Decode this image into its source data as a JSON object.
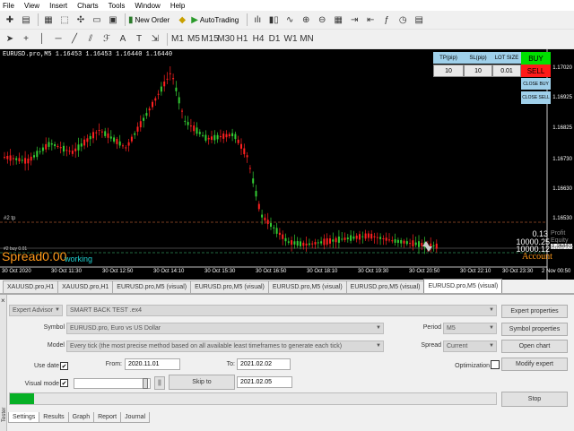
{
  "menu": [
    "File",
    "View",
    "Insert",
    "Charts",
    "Tools",
    "Window",
    "Help"
  ],
  "toolbar": {
    "new_order": "New Order",
    "autotrading": "AutoTrading"
  },
  "chart": {
    "title": "EURUSD.pro,M5  1.16453 1.16453 1.16440 1.16440",
    "y_ticks": [
      "1.17020",
      "1.16925",
      "1.16825",
      "1.16730",
      "1.16630",
      "1.16530",
      "1.16440"
    ],
    "current_price": "1.16440",
    "x_ticks": [
      "30 Oct 2020",
      "30 Oct 11:30",
      "30 Oct 12:50",
      "30 Oct 14:10",
      "30 Oct 15:30",
      "30 Oct 16:50",
      "30 Oct 18:10",
      "30 Oct 19:30",
      "30 Oct 20:50",
      "30 Oct 22:10",
      "30 Oct 23:30",
      "2 Nov 00:50"
    ],
    "tp_label": "#2 tp",
    "buy_line_label": "#2 buy 0.01",
    "spread_label": "Spread",
    "spread_value": "0.00",
    "status": "working",
    "profit_value": "0.13",
    "profit_label": "Profit",
    "equity_value": "10000.25",
    "equity_label": "Equity",
    "balance_value": "10000.12",
    "balance_label": "Balance",
    "account_label": "Account",
    "bull_color": "#33cc33",
    "bear_color": "#ff2020"
  },
  "panel": {
    "tp_header": "TP(pip)",
    "sl_header": "SL(pip)",
    "lot_header": "LOT SIZE",
    "tp_value": "10",
    "sl_value": "10",
    "lot_value": "0.01",
    "buy": "BUY",
    "sell": "SELL",
    "close_buy": "CLOSE BUY",
    "close_sell": "CLOSE SELL"
  },
  "chart_tabs": [
    "XAUUSD.pro,H1",
    "XAUUSD.pro,H1",
    "EURUSD.pro,M5 (visual)",
    "EURUSD.pro,M5 (visual)",
    "EURUSD.pro,M5 (visual)",
    "EURUSD.pro,M5 (visual)",
    "EURUSD.pro,M5 (visual)"
  ],
  "tester": {
    "expert_type": "Expert Advisor",
    "expert_file": "SMART BACK TEST .ex4",
    "symbol_label": "Symbol",
    "symbol_value": "EURUSD.pro, Euro vs US Dollar",
    "model_label": "Model",
    "model_value": "Every tick (the most precise method based on all available least timeframes to generate each tick)",
    "use_date_label": "Use date",
    "from_label": "From:",
    "from_value": "2020.11.01",
    "to_label": "To:",
    "to_value": "2021.02.02",
    "visual_mode_label": "Visual mode",
    "skip_to": "Skip to",
    "skip_date": "2021.02.05",
    "period_label": "Period",
    "period_value": "M5",
    "spread_label": "Spread",
    "spread_value": "Current",
    "optimization_label": "Optimization",
    "expert_properties": "Expert properties",
    "symbol_properties": "Symbol properties",
    "open_chart": "Open chart",
    "modify_expert": "Modify expert",
    "stop": "Stop",
    "side_label": "Tester",
    "progress": 0.05
  },
  "bottom_tabs": [
    "Settings",
    "Results",
    "Graph",
    "Report",
    "Journal"
  ]
}
